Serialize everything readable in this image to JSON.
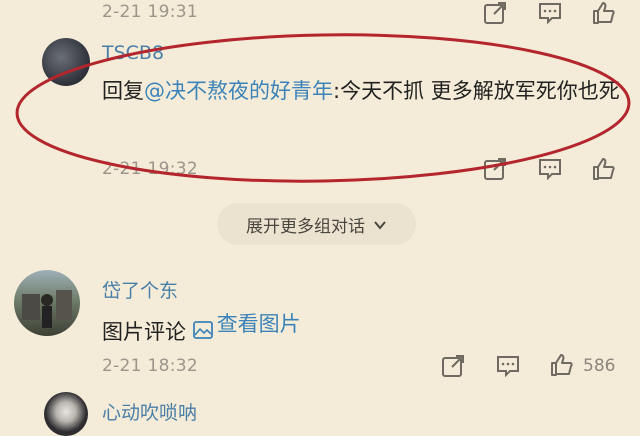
{
  "comments": [
    {
      "time": "2-21 19:31",
      "actions": {
        "share_icon": "share-icon",
        "reply_icon": "comment-icon",
        "like_icon": "thumbs-up-icon"
      }
    },
    {
      "username": "TSCB8",
      "reply_prefix": "回复",
      "mention": "@决不熬夜的好青年",
      "reply_colon": ":",
      "text": "今天不抓 更多解放军死你也死",
      "time": "2-21 19:32",
      "highlight_color": "#b3262d"
    },
    {
      "username": "岱了个东",
      "text": "图片评论",
      "image_link": "查看图片",
      "time": "2-21 18:32",
      "likes": "586"
    },
    {
      "username": "心动吹唢呐"
    }
  ],
  "expand_more": {
    "label": "展开更多组对话"
  },
  "colors": {
    "background": "#f4ecd8",
    "link": "#3b83b8",
    "circle": "#b3262d"
  }
}
